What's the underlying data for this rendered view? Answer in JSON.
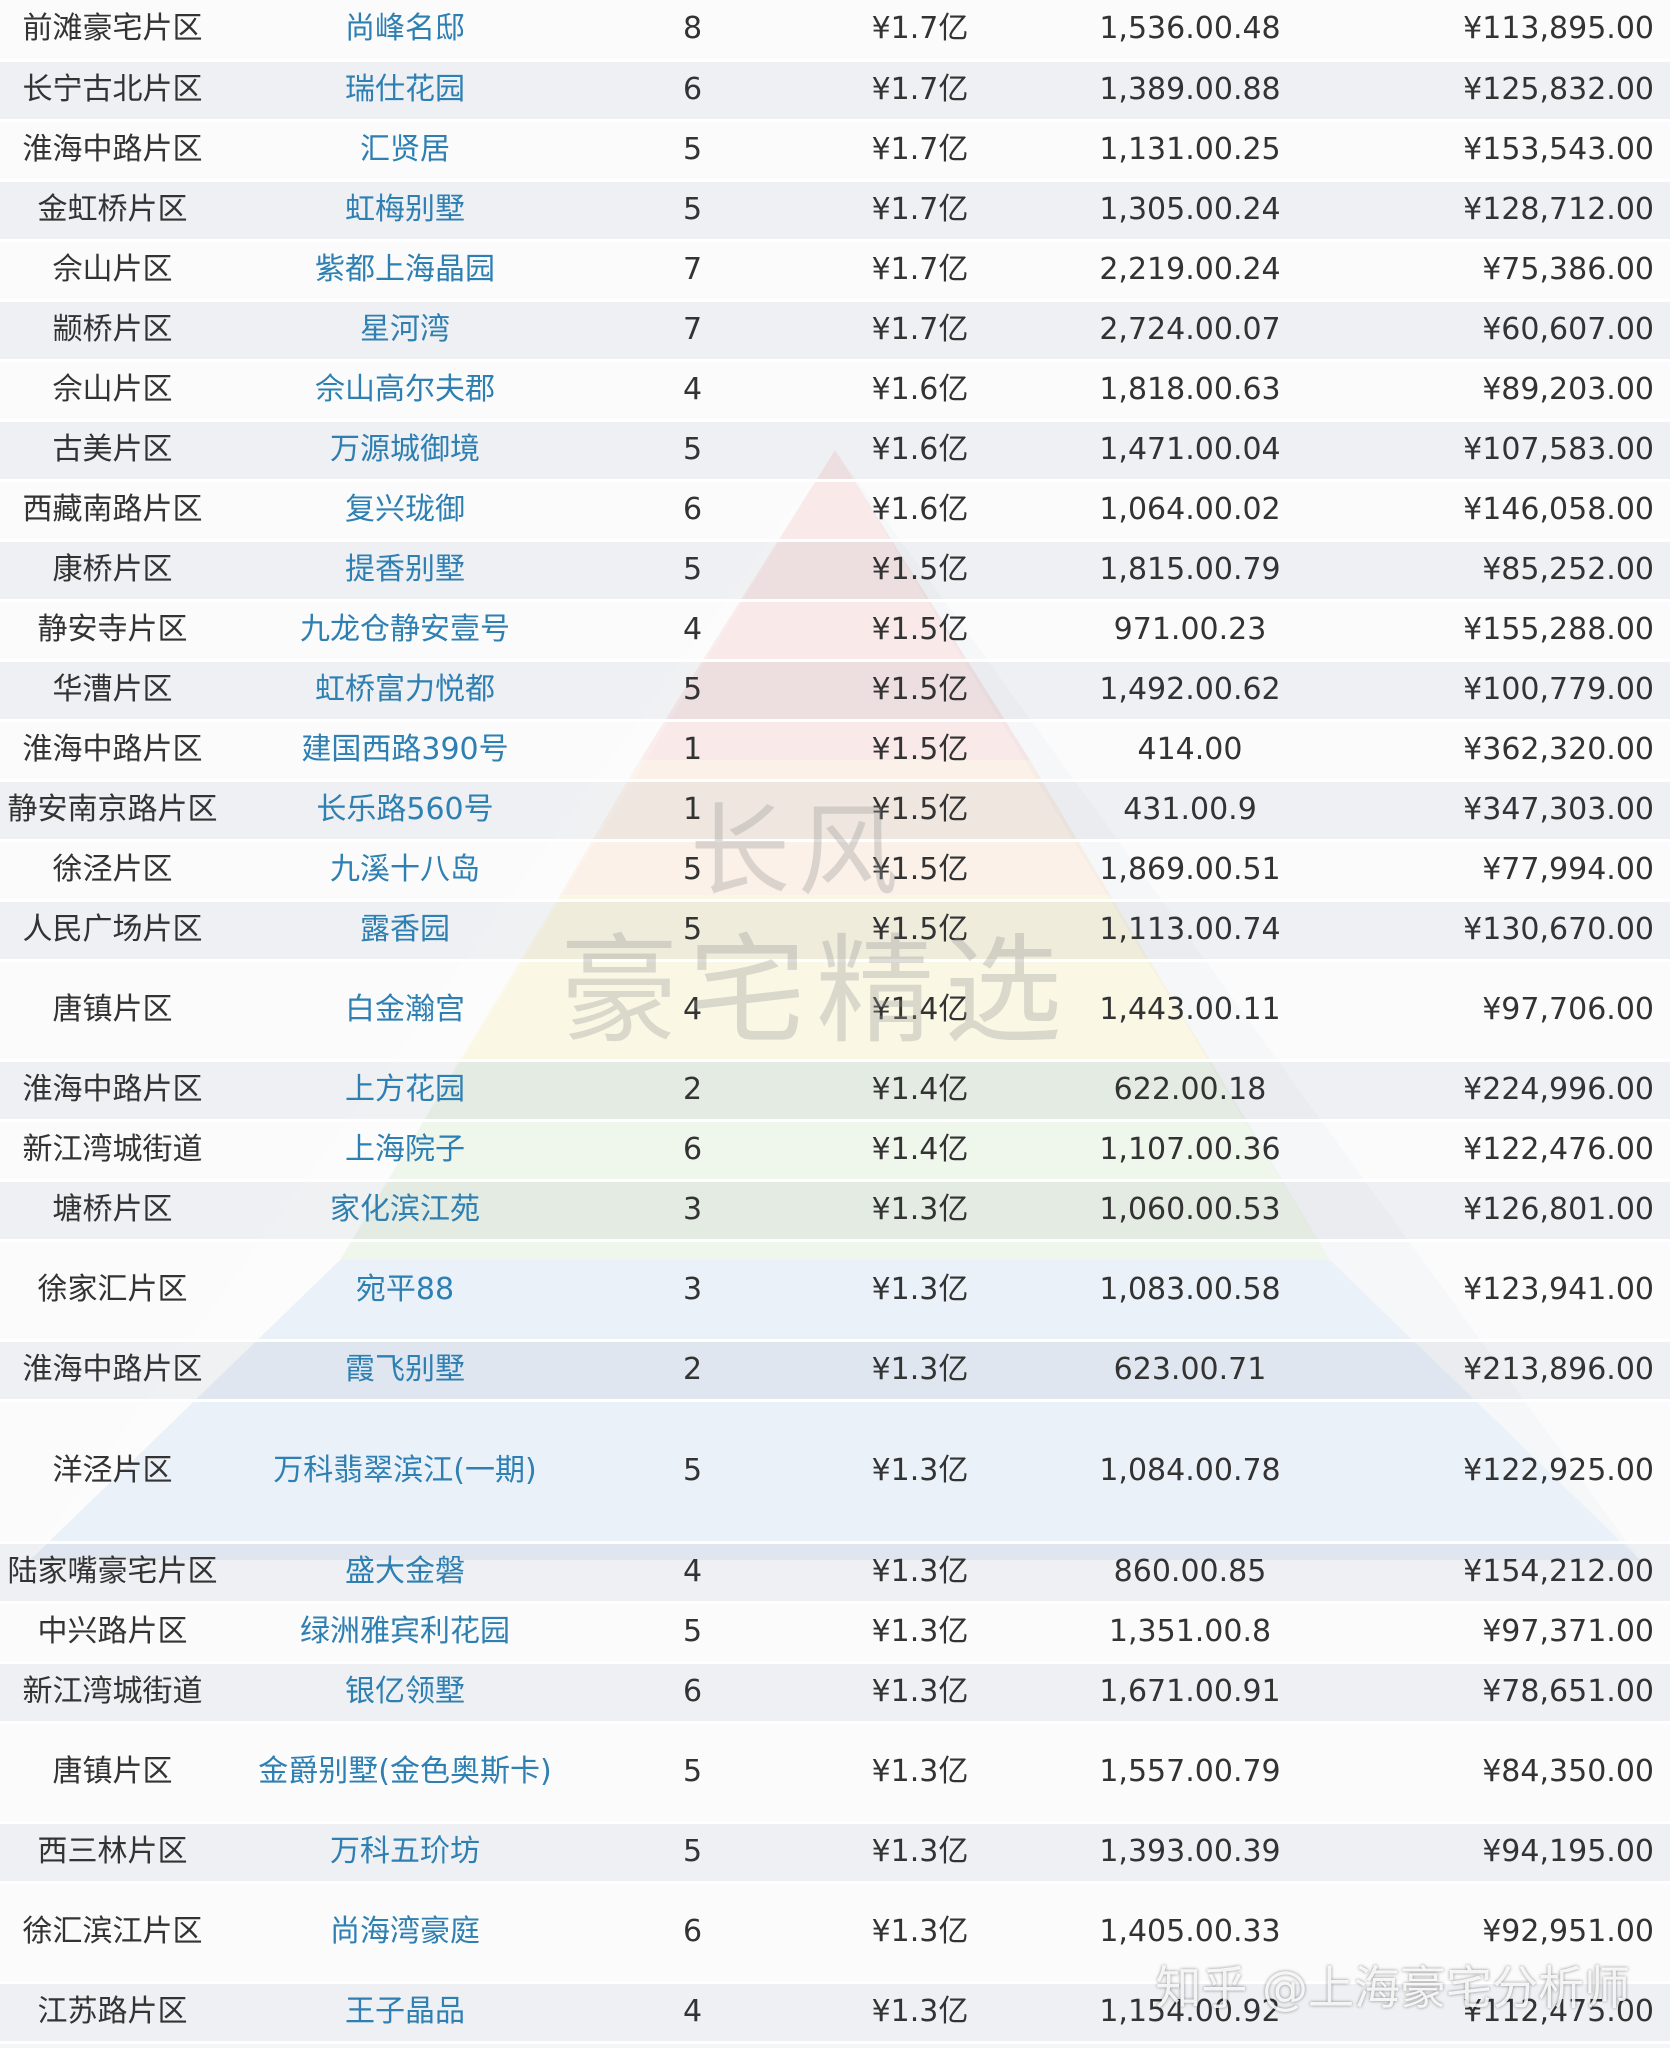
{
  "watermark": {
    "line1": "长风",
    "line2": "豪宅精选"
  },
  "credit": "知乎 @上海豪宅分析师",
  "rows": [
    {
      "district": "前滩豪宅片区",
      "project": "尚峰名邸",
      "units": "8",
      "total": "¥1.7亿",
      "area": "1,536.00.48",
      "unit_price": "¥113,895.00"
    },
    {
      "district": "长宁古北片区",
      "project": "瑞仕花园",
      "units": "6",
      "total": "¥1.7亿",
      "area": "1,389.00.88",
      "unit_price": "¥125,832.00"
    },
    {
      "district": "淮海中路片区",
      "project": "汇贤居",
      "units": "5",
      "total": "¥1.7亿",
      "area": "1,131.00.25",
      "unit_price": "¥153,543.00"
    },
    {
      "district": "金虹桥片区",
      "project": "虹梅别墅",
      "units": "5",
      "total": "¥1.7亿",
      "area": "1,305.00.24",
      "unit_price": "¥128,712.00"
    },
    {
      "district": "佘山片区",
      "project": "紫都上海晶园",
      "units": "7",
      "total": "¥1.7亿",
      "area": "2,219.00.24",
      "unit_price": "¥75,386.00"
    },
    {
      "district": "颛桥片区",
      "project": "星河湾",
      "units": "7",
      "total": "¥1.7亿",
      "area": "2,724.00.07",
      "unit_price": "¥60,607.00"
    },
    {
      "district": "佘山片区",
      "project": "佘山高尔夫郡",
      "units": "4",
      "total": "¥1.6亿",
      "area": "1,818.00.63",
      "unit_price": "¥89,203.00"
    },
    {
      "district": "古美片区",
      "project": "万源城御境",
      "units": "5",
      "total": "¥1.6亿",
      "area": "1,471.00.04",
      "unit_price": "¥107,583.00"
    },
    {
      "district": "西藏南路片区",
      "project": "复兴珑御",
      "units": "6",
      "total": "¥1.6亿",
      "area": "1,064.00.02",
      "unit_price": "¥146,058.00"
    },
    {
      "district": "康桥片区",
      "project": "提香别墅",
      "units": "5",
      "total": "¥1.5亿",
      "area": "1,815.00.79",
      "unit_price": "¥85,252.00"
    },
    {
      "district": "静安寺片区",
      "project": "九龙仓静安壹号",
      "units": "4",
      "total": "¥1.5亿",
      "area": "971.00.23",
      "unit_price": "¥155,288.00"
    },
    {
      "district": "华漕片区",
      "project": "虹桥富力悦都",
      "units": "5",
      "total": "¥1.5亿",
      "area": "1,492.00.62",
      "unit_price": "¥100,779.00"
    },
    {
      "district": "淮海中路片区",
      "project": "建国西路390号",
      "units": "1",
      "total": "¥1.5亿",
      "area": "414.00",
      "unit_price": "¥362,320.00"
    },
    {
      "district": "静安南京路片区",
      "project": "长乐路560号",
      "units": "1",
      "total": "¥1.5亿",
      "area": "431.00.9",
      "unit_price": "¥347,303.00"
    },
    {
      "district": "徐泾片区",
      "project": "九溪十八岛",
      "units": "5",
      "total": "¥1.5亿",
      "area": "1,869.00.51",
      "unit_price": "¥77,994.00"
    },
    {
      "district": "人民广场片区",
      "project": "露香园",
      "units": "5",
      "total": "¥1.5亿",
      "area": "1,113.00.74",
      "unit_price": "¥130,670.00"
    },
    {
      "district": "唐镇片区",
      "project": "白金瀚宫",
      "units": "4",
      "total": "¥1.4亿",
      "area": "1,443.00.11",
      "unit_price": "¥97,706.00",
      "tall": "r-tall"
    },
    {
      "district": "淮海中路片区",
      "project": "上方花园",
      "units": "2",
      "total": "¥1.4亿",
      "area": "622.00.18",
      "unit_price": "¥224,996.00"
    },
    {
      "district": "新江湾城街道",
      "project": "上海院子",
      "units": "6",
      "total": "¥1.4亿",
      "area": "1,107.00.36",
      "unit_price": "¥122,476.00"
    },
    {
      "district": "塘桥片区",
      "project": "家化滨江苑",
      "units": "3",
      "total": "¥1.3亿",
      "area": "1,060.00.53",
      "unit_price": "¥126,801.00"
    },
    {
      "district": "徐家汇片区",
      "project": "宛平88",
      "units": "3",
      "total": "¥1.3亿",
      "area": "1,083.00.58",
      "unit_price": "¥123,941.00",
      "tall": "r-tall"
    },
    {
      "district": "淮海中路片区",
      "project": "霞飞别墅",
      "units": "2",
      "total": "¥1.3亿",
      "area": "623.00.71",
      "unit_price": "¥213,896.00"
    },
    {
      "district": "洋泾片区",
      "project": "万科翡翠滨江(一期)",
      "units": "5",
      "total": "¥1.3亿",
      "area": "1,084.00.78",
      "unit_price": "¥122,925.00",
      "tall": "r-xtall"
    },
    {
      "district": "陆家嘴豪宅片区",
      "project": "盛大金磐",
      "units": "4",
      "total": "¥1.3亿",
      "area": "860.00.85",
      "unit_price": "¥154,212.00"
    },
    {
      "district": "中兴路片区",
      "project": "绿洲雅宾利花园",
      "units": "5",
      "total": "¥1.3亿",
      "area": "1,351.00.8",
      "unit_price": "¥97,371.00"
    },
    {
      "district": "新江湾城街道",
      "project": "银亿领墅",
      "units": "6",
      "total": "¥1.3亿",
      "area": "1,671.00.91",
      "unit_price": "¥78,651.00"
    },
    {
      "district": "唐镇片区",
      "project": "金爵别墅(金色奥斯卡)",
      "units": "5",
      "total": "¥1.3亿",
      "area": "1,557.00.79",
      "unit_price": "¥84,350.00",
      "tall": "r-tall"
    },
    {
      "district": "西三林片区",
      "project": "万科五玠坊",
      "units": "5",
      "total": "¥1.3亿",
      "area": "1,393.00.39",
      "unit_price": "¥94,195.00"
    },
    {
      "district": "徐汇滨江片区",
      "project": "尚海湾豪庭",
      "units": "6",
      "total": "¥1.3亿",
      "area": "1,405.00.33",
      "unit_price": "¥92,951.00",
      "tall": "r-tall"
    },
    {
      "district": "江苏路片区",
      "project": "王子晶品",
      "units": "4",
      "total": "¥1.3亿",
      "area": "1,154.00.92",
      "unit_price": "¥112,475.00"
    }
  ]
}
